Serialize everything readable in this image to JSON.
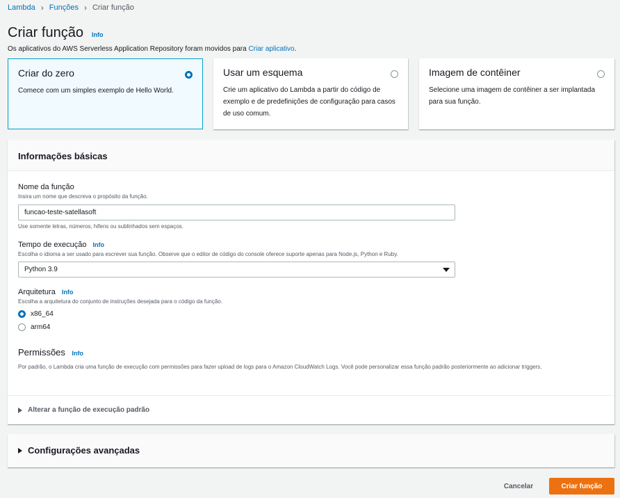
{
  "breadcrumb": {
    "items": [
      "Lambda",
      "Funções"
    ],
    "current": "Criar função"
  },
  "header": {
    "title": "Criar função",
    "info": "Info",
    "subtitle_text": "Os aplicativos do AWS Serverless Application Repository foram movidos para ",
    "subtitle_link": "Criar aplicativo",
    "subtitle_end": "."
  },
  "options": [
    {
      "title": "Criar do zero",
      "desc": "Comece com um simples exemplo de Hello World.",
      "selected": true
    },
    {
      "title": "Usar um esquema",
      "desc": "Crie um aplicativo do Lambda a partir do código de exemplo e de predefinições de configuração para casos de uso comum.",
      "selected": false
    },
    {
      "title": "Imagem de contêiner",
      "desc": "Selecione uma imagem de contêiner a ser implantada para sua função.",
      "selected": false
    }
  ],
  "basic": {
    "title": "Informações básicas",
    "name_label": "Nome da função",
    "name_desc": "Insira um nome que descreva o propósito da função.",
    "name_value": "funcao-teste-satellasoft",
    "name_hint": "Use somente letras, números, hifens ou sublinhados sem espaços.",
    "runtime_label": "Tempo de execução",
    "runtime_info": "Info",
    "runtime_desc": "Escolha o idioma a ser usado para escrever sua função. Observe que o editor de código do console oferece suporte apenas para Node.js, Python e Ruby.",
    "runtime_value": "Python 3.9",
    "arch_label": "Arquitetura",
    "arch_info": "Info",
    "arch_desc": "Escolha a arquitetura do conjunto de instruções desejada para o código da função.",
    "arch_options": [
      "x86_64",
      "arm64"
    ],
    "arch_selected": "x86_64",
    "perm_title": "Permissões",
    "perm_info": "Info",
    "perm_desc": "Por padrão, o Lambda cria uma função de execução com permissões para fazer upload de logs para o Amazon CloudWatch Logs. Você pode personalizar essa função padrão posteriormente ao adicionar triggers.",
    "perm_expander": "Alterar a função de execução padrão"
  },
  "advanced": {
    "title": "Configurações avançadas"
  },
  "footer": {
    "cancel": "Cancelar",
    "submit": "Criar função"
  },
  "colors": {
    "primary": "#ec7211",
    "link": "#0073bb",
    "selected_border": "#00a1c9"
  }
}
